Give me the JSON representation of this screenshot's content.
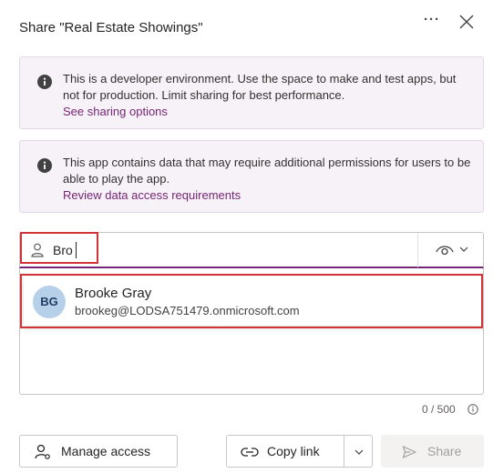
{
  "dialog": {
    "title": "Share \"Real Estate Showings\"",
    "more_label": "···"
  },
  "banners": [
    {
      "text": "This is a developer environment. Use the space to make and test apps, but not for production. Limit sharing for best performance.",
      "link": "See sharing options"
    },
    {
      "text": "This app contains data that may require additional permissions for users to be able to play the app.",
      "link": "Review data access requirements"
    }
  ],
  "search": {
    "value": "Bro"
  },
  "suggestion": {
    "initials": "BG",
    "name": "Brooke Gray",
    "email": "brookeg@LODSA751479.onmicrosoft.com"
  },
  "message": {
    "counter": "0 / 500"
  },
  "footer": {
    "manage_access": "Manage access",
    "copy_link": "Copy link",
    "share": "Share"
  },
  "colors": {
    "accent": "#742774",
    "highlight": "#d13438",
    "banner_bg": "#f7f1f8"
  }
}
